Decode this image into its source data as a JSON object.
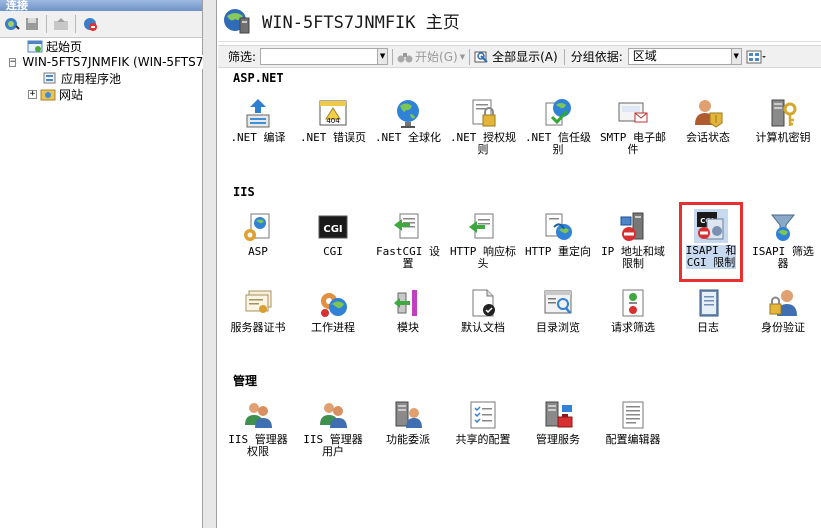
{
  "connections": {
    "header": "连接",
    "tree": [
      {
        "label": "起始页",
        "level": 1
      },
      {
        "label": "WIN-5FTS7JNMFIK (WIN-5FTS7",
        "level": 0,
        "expander": "−"
      },
      {
        "label": "应用程序池",
        "level": 2
      },
      {
        "label": "网站",
        "level": 1,
        "expander": "+"
      }
    ]
  },
  "page": {
    "title": "WIN-5FTS7JNMFIK 主页"
  },
  "filter_bar": {
    "filter_label": "筛选:",
    "start_label": "开始(G)",
    "show_all_label": "全部显示(A)",
    "group_by_label": "分组依据:",
    "group_by_value": "区域"
  },
  "groups": {
    "aspnet": {
      "title": "ASP.NET",
      "items": [
        {
          "label": ".NET 编译",
          "icon": "net-compile-icon"
        },
        {
          "label": ".NET 错误页",
          "icon": "error-page-icon"
        },
        {
          "label": ".NET 全球化",
          "icon": "globe-icon"
        },
        {
          "label": ".NET 授权规\n则",
          "icon": "lock-doc-icon"
        },
        {
          "label": ".NET 信任级\n别",
          "icon": "trust-check-icon"
        },
        {
          "label": "SMTP 电子邮\n件",
          "icon": "email-icon"
        },
        {
          "label": "会话状态",
          "icon": "session-icon"
        },
        {
          "label": "计算机密钥",
          "icon": "machine-key-icon"
        }
      ]
    },
    "iis": {
      "title": "IIS",
      "items": [
        {
          "label": "ASP",
          "icon": "asp-icon"
        },
        {
          "label": "CGI",
          "icon": "cgi-icon"
        },
        {
          "label": "FastCGI 设\n置",
          "icon": "fastcgi-icon"
        },
        {
          "label": "HTTP 响应标\n头",
          "icon": "http-headers-icon"
        },
        {
          "label": "HTTP 重定向",
          "icon": "redirect-icon"
        },
        {
          "label": "IP 地址和域\n限制",
          "icon": "ip-restrict-icon"
        },
        {
          "label": "ISAPI 和\nCGI 限制",
          "icon": "isapi-cgi-icon",
          "selected": true
        },
        {
          "label": "ISAPI 筛选\n器",
          "icon": "isapi-filter-icon"
        },
        {
          "label": "服务器证书",
          "icon": "certificate-icon"
        },
        {
          "label": "工作进程",
          "icon": "worker-process-icon"
        },
        {
          "label": "模块",
          "icon": "modules-icon"
        },
        {
          "label": "默认文档",
          "icon": "default-doc-icon"
        },
        {
          "label": "目录浏览",
          "icon": "dir-browse-icon"
        },
        {
          "label": "请求筛选",
          "icon": "request-filter-icon"
        },
        {
          "label": "日志",
          "icon": "log-icon"
        },
        {
          "label": "身份验证",
          "icon": "auth-icon"
        }
      ]
    },
    "manage": {
      "title": "管理",
      "items": [
        {
          "label": "IIS 管理器\n权限",
          "icon": "mgr-perm-icon"
        },
        {
          "label": "IIS 管理器\n用户",
          "icon": "mgr-users-icon"
        },
        {
          "label": "功能委派",
          "icon": "delegation-icon"
        },
        {
          "label": "共享的配置",
          "icon": "shared-config-icon"
        },
        {
          "label": "管理服务",
          "icon": "mgmt-service-icon"
        },
        {
          "label": "配置编辑器",
          "icon": "config-editor-icon"
        }
      ]
    }
  },
  "colors": {
    "selection_outline": "#e83030",
    "selection_fill": "#c7d9ef"
  }
}
